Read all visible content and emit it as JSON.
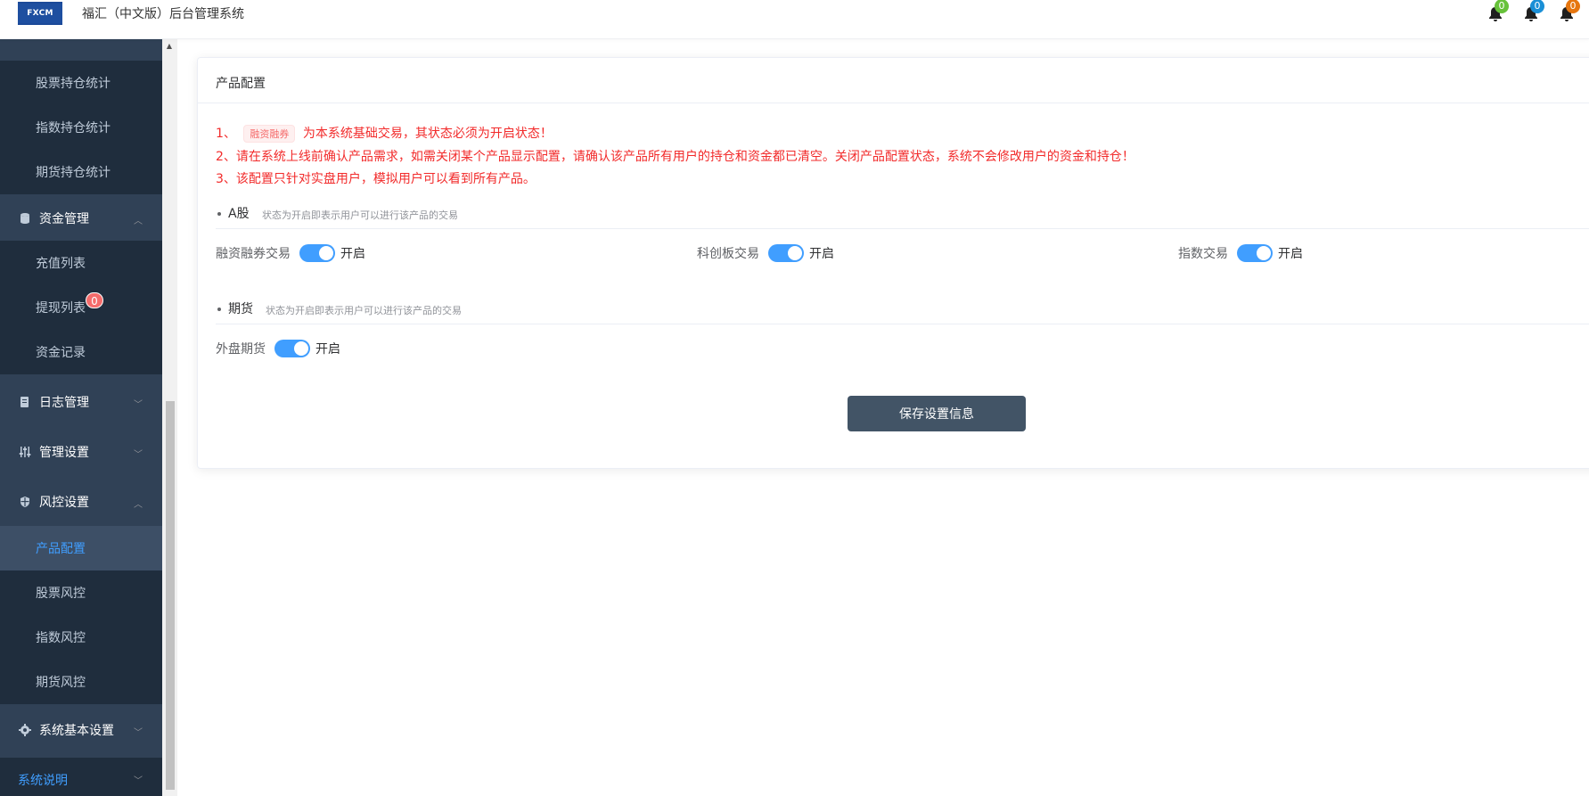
{
  "header": {
    "logo_text": "FXCM",
    "title": "福汇（中文版）后台管理系统",
    "notifications": [
      {
        "icon": "bell-icon",
        "count": "0",
        "color": "#67c23a"
      },
      {
        "icon": "bell-icon",
        "count": "0",
        "color": "#1a8fd6"
      },
      {
        "icon": "bell-icon",
        "count": "0",
        "color": "#e6760f"
      }
    ]
  },
  "sidebar": {
    "items": [
      {
        "label": "股票持仓统计"
      },
      {
        "label": "指数持仓统计"
      },
      {
        "label": "期货持仓统计"
      },
      {
        "label": "资金管理",
        "icon": "database-icon"
      },
      {
        "label": "充值列表"
      },
      {
        "label": "提现列表",
        "badge": "0"
      },
      {
        "label": "资金记录"
      },
      {
        "label": "日志管理",
        "icon": "log-icon"
      },
      {
        "label": "管理设置",
        "icon": "sliders-icon"
      },
      {
        "label": "风控设置",
        "icon": "shield-icon"
      },
      {
        "label": "产品配置"
      },
      {
        "label": "股票风控"
      },
      {
        "label": "指数风控"
      },
      {
        "label": "期货风控"
      },
      {
        "label": "系统基本设置",
        "icon": "gear-icon"
      },
      {
        "label": "系统说明"
      }
    ]
  },
  "main": {
    "card_title": "产品配置",
    "notices": {
      "n1_prefix": "1、",
      "n1_tag": "融资融券",
      "n1_suffix": "为本系统基础交易，其状态必须为开启状态！",
      "n2": "2、请在系统上线前确认产品需求，如需关闭某个产品显示配置，请确认该产品所有用户的持仓和资金都已清空。关闭产品配置状态，系统不会修改用户的资金和持仓！",
      "n3": "3、该配置只针对实盘用户，模拟用户可以看到所有产品。"
    },
    "sections": [
      {
        "title": "A股",
        "subtitle": "状态为开启即表示用户可以进行该产品的交易"
      },
      {
        "title": "期货",
        "subtitle": "状态为开启即表示用户可以进行该产品的交易"
      }
    ],
    "switches": [
      {
        "label": "融资融券交易",
        "state": "开启"
      },
      {
        "label": "科创板交易",
        "state": "开启"
      },
      {
        "label": "指数交易",
        "state": "开启"
      },
      {
        "label": "外盘期货",
        "state": "开启"
      }
    ],
    "save_label": "保存设置信息"
  }
}
